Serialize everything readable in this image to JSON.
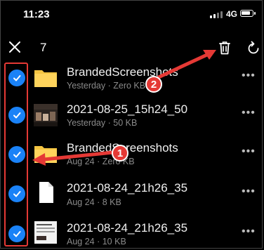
{
  "status_bar": {
    "time": "11:23",
    "network": "4G"
  },
  "toolbar": {
    "selected_count": "7",
    "close_icon": "close-icon",
    "delete_icon": "trash-icon",
    "refresh_icon": "refresh-icon"
  },
  "files": [
    {
      "name": "BrandedScreenshots",
      "meta": "Yesterday · Zero KB",
      "type": "folder",
      "selected": true
    },
    {
      "name": "2021-08-25_15h24_50",
      "meta": "Yesterday · 50 KB",
      "type": "image-dark",
      "selected": true
    },
    {
      "name": "BrandedScreenshots",
      "meta": "Aug 24 · Zero KB",
      "type": "folder",
      "selected": true
    },
    {
      "name": "2021-08-24_21h26_35",
      "meta": "Aug 24 · 8 KB",
      "type": "document",
      "selected": true
    },
    {
      "name": "2021-08-24_21h26_35",
      "meta": "Aug 24 · 10 KB",
      "type": "image-light",
      "selected": true
    }
  ],
  "more_label": "•••",
  "annotations": {
    "step1": "1",
    "step2": "2",
    "color": "#e53935"
  },
  "colors": {
    "check": "#1a82f7",
    "folder": "#f5c542",
    "background": "#000000"
  }
}
